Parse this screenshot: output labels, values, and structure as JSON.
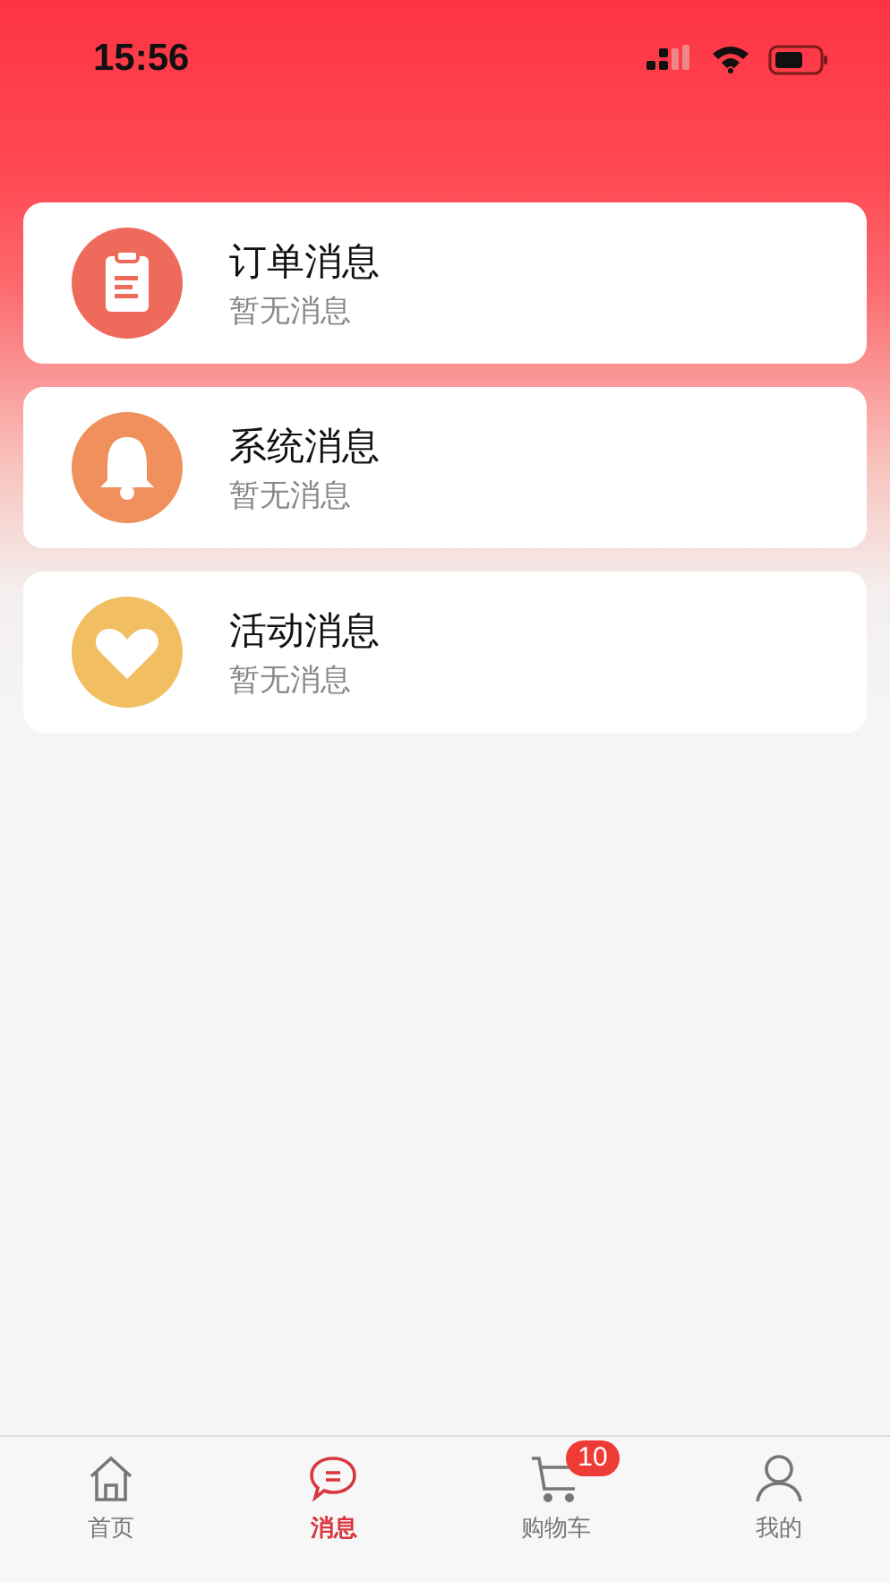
{
  "status_bar": {
    "time": "15:56"
  },
  "messages": [
    {
      "kind": "order",
      "title": "订单消息",
      "subtitle": "暂无消息",
      "color": "#ee6b5c"
    },
    {
      "kind": "system",
      "title": "系统消息",
      "subtitle": "暂无消息",
      "color": "#f0905c"
    },
    {
      "kind": "activity",
      "title": "活动消息",
      "subtitle": "暂无消息",
      "color": "#f1bf62"
    }
  ],
  "tab_bar": [
    {
      "kind": "home",
      "label": "首页",
      "selected": false
    },
    {
      "kind": "messages",
      "label": "消息",
      "selected": true
    },
    {
      "kind": "cart",
      "label": "购物车",
      "selected": false,
      "badge": "10"
    },
    {
      "kind": "profile",
      "label": "我的",
      "selected": false
    }
  ]
}
